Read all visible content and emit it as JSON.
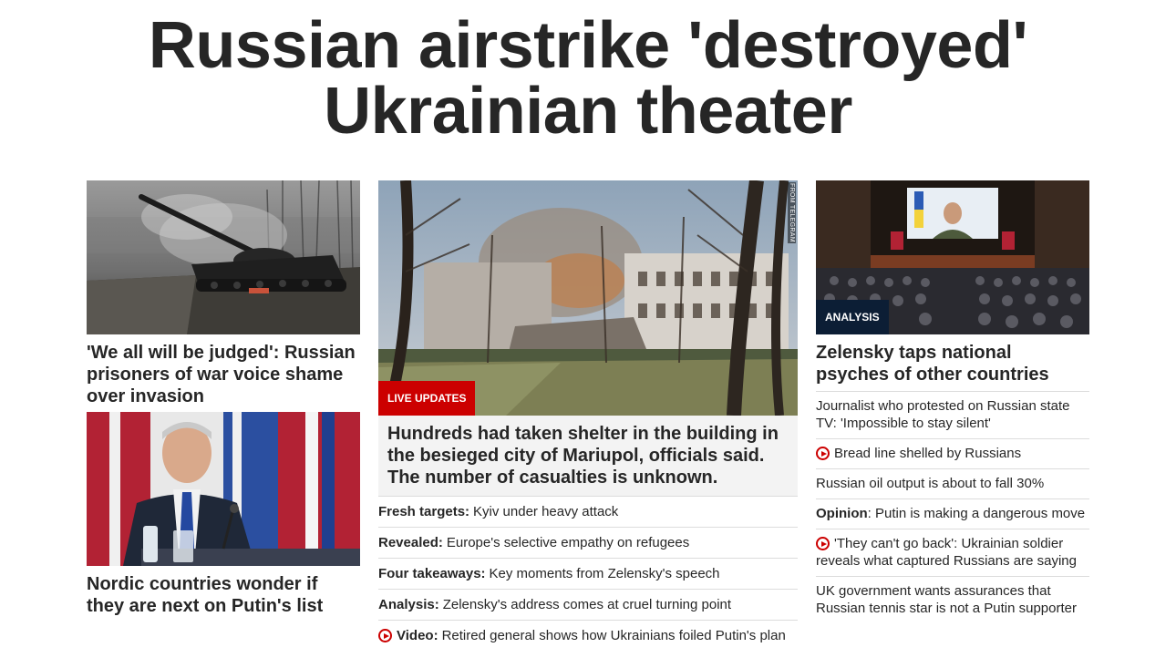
{
  "headline": "Russian airstrike 'destroyed' Ukrainian theater",
  "left": {
    "card1": {
      "title": "'We all will be judged': Russian prisoners of war voice shame over invasion"
    },
    "card2": {
      "title": "Nordic countries wonder if they are next on Putin's list"
    }
  },
  "center": {
    "badge": "LIVE UPDATES",
    "credit": "FROM TELEGRAM",
    "summary": "Hundreds had taken shelter in the building in the besieged city of Mariupol, officials said. The number of casualties is unknown.",
    "links": [
      {
        "lead": "Fresh targets:",
        "text": "Kyiv under heavy attack",
        "video": false
      },
      {
        "lead": "Revealed:",
        "text": "Europe's selective empathy on refugees",
        "video": false
      },
      {
        "lead": "Four takeaways:",
        "text": "Key moments from Zelensky's speech",
        "video": false
      },
      {
        "lead": "Analysis:",
        "text": "Zelensky's address comes at cruel turning point",
        "video": false
      },
      {
        "lead": "Video:",
        "text": "Retired general shows how Ukrainians foiled Putin's plan",
        "video": true,
        "icon": "play-icon"
      }
    ]
  },
  "right": {
    "badge": "ANALYSIS",
    "title": "Zelensky taps national psyches of other countries",
    "links": [
      {
        "text": "Journalist who protested on Russian state TV: 'Impossible to stay silent'"
      },
      {
        "text": "Bread line shelled by Russians",
        "video": true
      },
      {
        "text": "Russian oil output is about to fall 30%"
      },
      {
        "lead": "Opinion",
        "text": ": Putin is making a dangerous move"
      },
      {
        "text": "'They can't go back': Ukrainian soldier reveals what captured Russians are saying",
        "video": true
      },
      {
        "text": "UK government wants assurances that Russian tennis star is not a Putin supporter"
      }
    ]
  },
  "colors": {
    "accent": "#cc0000",
    "analysis_badge": "#0c1e35",
    "text": "#262626"
  }
}
